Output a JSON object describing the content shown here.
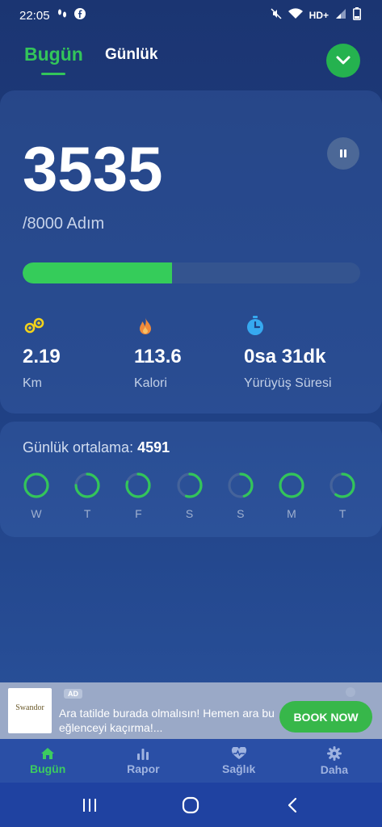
{
  "status_bar": {
    "time": "22:05",
    "network": "HD+",
    "icons": [
      "footprints-icon",
      "facebook-icon",
      "mute-icon",
      "wifi-icon",
      "signal-icon",
      "battery-icon"
    ]
  },
  "header": {
    "tabs": [
      {
        "label": "Bugün",
        "active": true
      },
      {
        "label": "Günlük",
        "active": false
      }
    ],
    "dropdown_icon": "chevron-down-icon"
  },
  "today": {
    "steps": "3535",
    "goal_text": "/8000 Adım",
    "progress_fraction": 0.442,
    "stats": [
      {
        "value": "2.19",
        "label": "Km",
        "icon": "footprints-icon",
        "color": "#f3d31a"
      },
      {
        "value": "113.6",
        "label": "Kalori",
        "icon": "flame-icon",
        "color": "#f08a3a"
      },
      {
        "value": "0sa 31dk",
        "label": "Yürüyüş Süresi",
        "icon": "stopwatch-icon",
        "color": "#36a9f0"
      }
    ]
  },
  "daily_average": {
    "label": "Günlük ortalama:",
    "value": "4591",
    "days": [
      {
        "label": "W",
        "fraction": 0.97
      },
      {
        "label": "T",
        "fraction": 0.75
      },
      {
        "label": "F",
        "fraction": 0.8
      },
      {
        "label": "S",
        "fraction": 0.55
      },
      {
        "label": "S",
        "fraction": 0.45
      },
      {
        "label": "M",
        "fraction": 1.0
      },
      {
        "label": "T",
        "fraction": 0.6
      }
    ]
  },
  "ad": {
    "badge": "AD",
    "logo_text": "Swandor",
    "text": "Ara tatilde burada olmalısın! Hemen ara bu eğlenceyi kaçırma!...",
    "button": "BOOK NOW"
  },
  "bottom_nav": [
    {
      "label": "Bugün",
      "icon": "home-icon",
      "active": true
    },
    {
      "label": "Rapor",
      "icon": "bar-chart-icon",
      "active": false
    },
    {
      "label": "Sağlık",
      "icon": "heart-pulse-icon",
      "active": false
    },
    {
      "label": "Daha",
      "icon": "gear-icon",
      "active": false
    }
  ],
  "colors": {
    "accent_green": "#33c55a",
    "background": "#1f3f82",
    "nav_bar": "#2a4fa6"
  }
}
